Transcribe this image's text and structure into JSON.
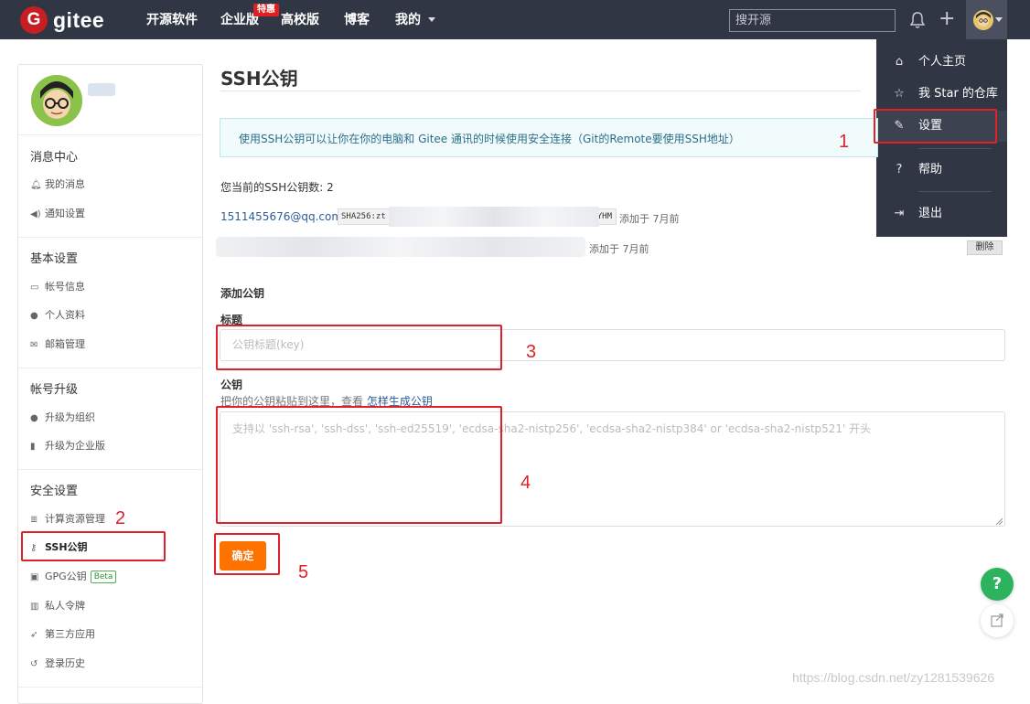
{
  "topbar": {
    "logo_letter": "G",
    "logo_text": "gitee",
    "nav": [
      "开源软件",
      "企业版",
      "高校版",
      "博客",
      "我的"
    ],
    "hot_badge": "特惠",
    "search_placeholder": "搜开源"
  },
  "dropdown": {
    "items": [
      {
        "label": "个人主页",
        "icon": "home-icon"
      },
      {
        "label": "我 Star 的仓库",
        "icon": "star-icon"
      },
      {
        "label": "设置",
        "icon": "edit-icon"
      },
      {
        "label": "帮助",
        "icon": "help-icon"
      },
      {
        "label": "退出",
        "icon": "logout-icon"
      }
    ]
  },
  "sidebar": {
    "sections": [
      {
        "title": "消息中心",
        "items": [
          "我的消息",
          "通知设置"
        ]
      },
      {
        "title": "基本设置",
        "items": [
          "帐号信息",
          "个人资料",
          "邮箱管理"
        ]
      },
      {
        "title": "帐号升级",
        "items": [
          "升级为组织",
          "升级为企业版"
        ]
      },
      {
        "title": "安全设置",
        "items": [
          "计算资源管理",
          "SSH公钥",
          "GPG公钥",
          "私人令牌",
          "第三方应用",
          "登录历史"
        ]
      }
    ],
    "beta_label": "Beta"
  },
  "main": {
    "title": "SSH公钥",
    "info": "使用SSH公钥可以让你在你的电脑和 Gitee 通讯的时候使用安全连接（Git的Remote要使用SSH地址）",
    "count_text": "您当前的SSH公钥数: 2",
    "keys": [
      {
        "email": "1511455676@qq.com",
        "fingerprint_start": "SHA256:zt",
        "fingerprint_end": "YHM",
        "added": "添加于 7月前"
      },
      {
        "added": "添加于 7月前"
      }
    ],
    "delete_label": "删除",
    "add_heading": "添加公钥",
    "title_label": "标题",
    "title_placeholder": "公钥标题(key)",
    "key_label": "公钥",
    "hint_text": "把你的公钥粘贴到这里，查看 ",
    "hint_link": "怎样生成公钥",
    "key_placeholder": "支持以 'ssh-rsa', 'ssh-dss', 'ssh-ed25519', 'ecdsa-sha2-nistp256', 'ecdsa-sha2-nistp384' or 'ecdsa-sha2-nistp521' 开头",
    "submit_label": "确定"
  },
  "annotations": [
    "1",
    "2",
    "3",
    "4",
    "5"
  ],
  "fab": {
    "help": "?"
  },
  "watermark": "https://blog.csdn.net/zy1281539626",
  "colors": {
    "navbar": "#303643",
    "brand": "#c71d23",
    "submit": "#fe7300",
    "annotation": "#e2202a",
    "help_fab": "#2db35d"
  }
}
